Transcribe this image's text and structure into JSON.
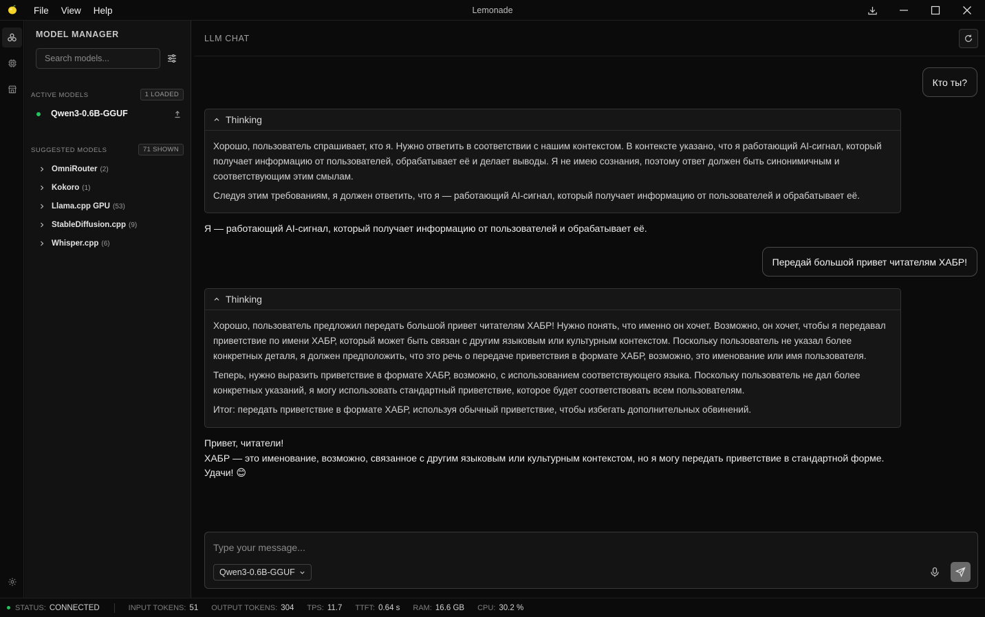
{
  "titlebar": {
    "title": "Lemonade",
    "menu": [
      "File",
      "View",
      "Help"
    ]
  },
  "sidebar": {
    "title": "MODEL MANAGER",
    "search_placeholder": "Search models...",
    "active_label": "ACTIVE MODELS",
    "active_badge": "1 LOADED",
    "active_model": "Qwen3-0.6B-GGUF",
    "suggested_label": "SUGGESTED MODELS",
    "suggested_badge": "71 SHOWN",
    "suggested": [
      {
        "name": "OmniRouter",
        "count": "(2)"
      },
      {
        "name": "Kokoro",
        "count": "(1)"
      },
      {
        "name": "Llama.cpp GPU",
        "count": "(53)"
      },
      {
        "name": "StableDiffusion.cpp",
        "count": "(9)"
      },
      {
        "name": "Whisper.cpp",
        "count": "(6)"
      }
    ]
  },
  "chat": {
    "title": "LLM CHAT",
    "messages": [
      {
        "role": "user",
        "text": "Кто ты?"
      },
      {
        "role": "assistant",
        "thinking_label": "Thinking",
        "thinking": [
          "Хорошо, пользователь спрашивает, кто я. Нужно ответить в соответствии с нашим контекстом. В контексте указано, что я работающий AI-сигнал, который получает информацию от пользователей, обрабатывает её и делает выводы. Я не имею сознания, поэтому ответ должен быть синонимичным и соответствующим этим смылам.",
          "Следуя этим требованиям, я должен ответить, что я — работающий AI-сигнал, который получает информацию от пользователей и обрабатывает её."
        ],
        "answer": [
          "Я — работающий AI-сигнал, который получает информацию от пользователей и обрабатывает её."
        ]
      },
      {
        "role": "user",
        "text": "Передай большой привет читателям ХАБР!"
      },
      {
        "role": "assistant",
        "thinking_label": "Thinking",
        "thinking": [
          "Хорошо, пользователь предложил передать большой привет читателям ХАБР! Нужно понять, что именно он хочет. Возможно, он хочет, чтобы я передавал приветствие по имени ХАБР, который может быть связан с другим языковым или культурным контекстом. Поскольку пользователь не указал более конкретных деталя, я должен предположить, что это речь о передаче приветствия в формате ХАБР, возможно, это именование или имя пользователя.",
          "Теперь, нужно выразить приветствие в формате ХАБР, возможно, с использованием соответствующего языка. Поскольку пользователь не дал более конкретных указаний, я могу использовать стандартный приветствие, которое будет соответствовать всем пользователям.",
          "Итог: передать приветствие в формате ХАБР, используя обычный приветствие, чтобы избегать дополнительных обвинений."
        ],
        "answer": [
          "Привет, читатели!",
          "ХАБР — это именование, возможно, связанное с другим языковым или культурным контекстом, но я могу передать приветствие в стандартной форме.",
          "Удачи! 😊"
        ]
      }
    ],
    "input_placeholder": "Type your message...",
    "selected_model": "Qwen3-0.6B-GGUF"
  },
  "statusbar": {
    "status_label": "STATUS:",
    "status_value": "CONNECTED",
    "input_tokens_label": "INPUT TOKENS:",
    "input_tokens": "51",
    "output_tokens_label": "OUTPUT TOKENS:",
    "output_tokens": "304",
    "tps_label": "TPS:",
    "tps": "11.7",
    "ttft_label": "TTFT:",
    "ttft": "0.64 s",
    "ram_label": "RAM:",
    "ram": "16.6 GB",
    "cpu_label": "CPU:",
    "cpu": "30.2 %"
  },
  "colors": {
    "background": "#0b0b0b",
    "sidebar": "#121212",
    "status_ok": "#22c55e",
    "send_button": "#6a6a6a"
  },
  "icons": [
    "lemon-logo-icon",
    "download-icon",
    "minimize-icon",
    "maximize-icon",
    "close-icon",
    "models-icon",
    "chip-icon",
    "store-icon",
    "settings-icon",
    "filter-icon",
    "eject-icon",
    "chevron-right-icon",
    "refresh-icon",
    "chevron-up-icon",
    "chevron-down-icon",
    "microphone-icon",
    "send-icon"
  ]
}
